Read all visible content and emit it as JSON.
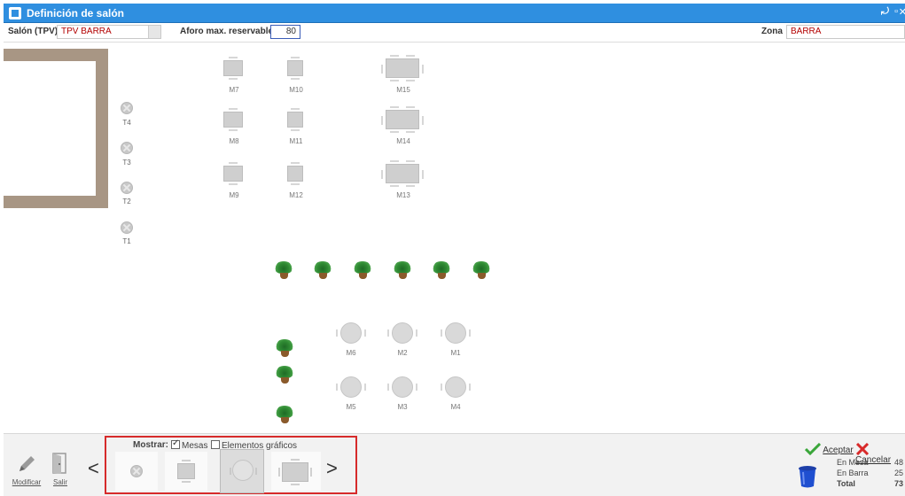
{
  "window": {
    "title": "Definición de salón"
  },
  "filters": {
    "salon_label": "Salón (TPV)",
    "salon_value": "TPV BARRA",
    "aforo_label": "Aforo max. reservable",
    "aforo_value": "80",
    "zona_label": "Zona",
    "zona_value": "BARRA"
  },
  "tables_rect": [
    {
      "id": "M7"
    },
    {
      "id": "M10"
    },
    {
      "id": "M15"
    },
    {
      "id": "M8"
    },
    {
      "id": "M11"
    },
    {
      "id": "M14"
    },
    {
      "id": "M9"
    },
    {
      "id": "M12"
    },
    {
      "id": "M13"
    }
  ],
  "stools": [
    "T4",
    "T3",
    "T2",
    "T1"
  ],
  "tables_round": [
    "M6",
    "M2",
    "M1",
    "M5",
    "M3",
    "M4"
  ],
  "footer": {
    "modificar": "Modificar",
    "salir": "Salir",
    "prev": "<",
    "next": ">",
    "mostrar": "Mostrar:",
    "mesas": "Mesas",
    "mesas_checked": true,
    "elementos": "Elementos gráficos",
    "elementos_checked": false,
    "aceptar": "Aceptar",
    "cancelar": "Cancelar",
    "stats": [
      {
        "label": "En Mesa",
        "value": "48"
      },
      {
        "label": "En Barra",
        "value": "25"
      },
      {
        "label": "Total",
        "value": "73"
      }
    ]
  },
  "colors": {
    "titlebar": "#2f8fe0",
    "accent_red": "#d62b2b",
    "bar_wall": "#a89684"
  }
}
